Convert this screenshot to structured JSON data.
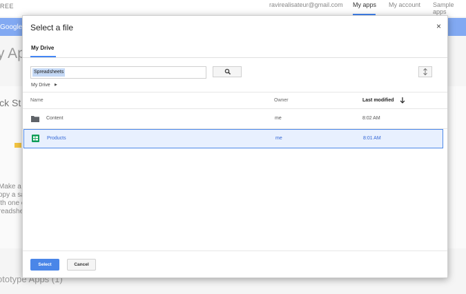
{
  "background": {
    "brand": "REE",
    "email": "ravirealisateur@gmail.com",
    "nav": [
      "My apps",
      "My account",
      "Sample apps"
    ],
    "bluebar_text": "Google C",
    "apps_heading": "y Ap",
    "quickstart": "ick St",
    "make_lines": [
      "Make a n",
      "opy a sa",
      "ith one c",
      "readshe"
    ],
    "prototype_heading": "ototype Apps (1)"
  },
  "dialog": {
    "title": "Select a file",
    "close": "×",
    "tab": "My Drive",
    "search_value": "Spreadsheets",
    "breadcrumb": "My Drive",
    "columns": {
      "name": "Name",
      "owner": "Owner",
      "modified": "Last modified"
    },
    "rows": [
      {
        "name": "Content",
        "owner": "me",
        "modified": "8:02 AM",
        "type": "folder-icon"
      },
      {
        "name": "Products",
        "owner": "me",
        "modified": "8:01 AM",
        "type": "spreadsheet-icon",
        "selected": true
      }
    ],
    "select_label": "Select",
    "cancel_label": "Cancel"
  },
  "colors": {
    "accent": "#4285f4",
    "selected_bg": "#e8f0fe",
    "selected_text": "#3367d6",
    "sheet_green": "#0f9d58"
  }
}
